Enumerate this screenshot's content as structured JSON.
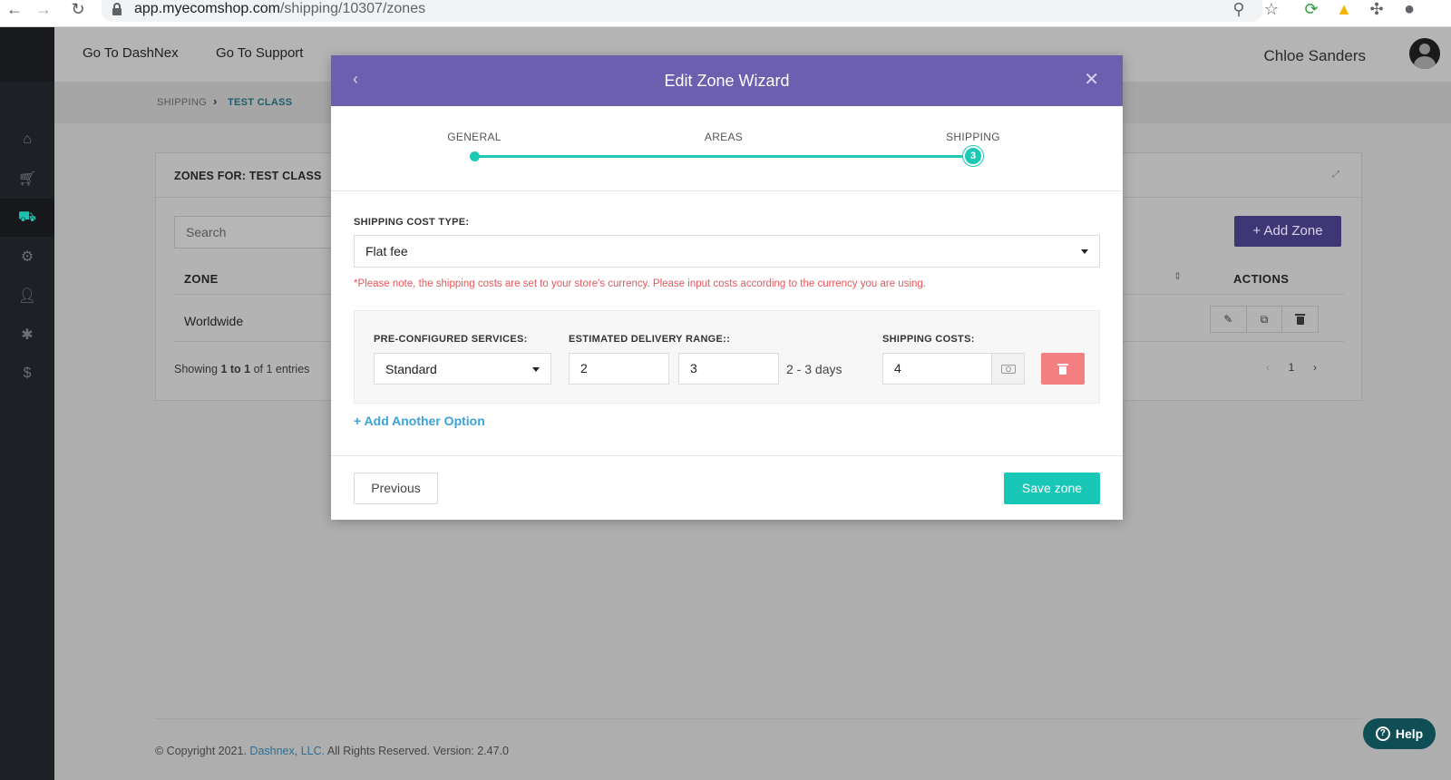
{
  "browser": {
    "url_host": "app.myecomshop.com",
    "url_path": "/shipping/10307/zones"
  },
  "header": {
    "link_dashnex": "Go To DashNex",
    "link_support": "Go To Support",
    "user_name": "Chloe Sanders"
  },
  "breadcrumb": {
    "items": [
      "SHIPPING",
      "TEST CLASS"
    ]
  },
  "card": {
    "title": "ZONES FOR: TEST CLASS",
    "search_placeholder": "Search",
    "add_zone_label": "Add Zone",
    "col_zone": "ZONE",
    "col_actions": "ACTIONS",
    "rows": [
      {
        "zone": "Worldwide"
      }
    ],
    "showing_prefix": "Showing ",
    "showing_from": "1",
    "showing_to_word": " to ",
    "showing_to": "1",
    "showing_of": " of 1 entries",
    "page_current": "1"
  },
  "footer": {
    "copyright": "© Copyright 2021. ",
    "company": "Dashnex, LLC.",
    "rest": " All Rights Reserved. Version: 2.47.0"
  },
  "help": {
    "label": "Help"
  },
  "modal": {
    "title": "Edit Zone Wizard",
    "steps": [
      "GENERAL",
      "AREAS",
      "SHIPPING"
    ],
    "current_step": "3",
    "cost_type_label": "SHIPPING COST TYPE:",
    "cost_type_value": "Flat fee",
    "currency_note": "*Please note, the shipping costs are set to your store's currency. Please input costs according to the currency you are using.",
    "services_label": "PRE-CONFIGURED SERVICES:",
    "services_value": "Standard",
    "delivery_label": "ESTIMATED DELIVERY RANGE::",
    "delivery_min": "2",
    "delivery_max": "3",
    "delivery_text": "2 - 3 days",
    "costs_label": "SHIPPING COSTS:",
    "costs_value": "4",
    "add_option_label": "+ Add Another Option",
    "previous_label": "Previous",
    "save_label": "Save zone"
  },
  "colors": {
    "modal_header": "#6c5fb0",
    "accent_teal": "#18c7b6",
    "danger": "#f47f80",
    "note_red": "#e8565b",
    "link_blue": "#3aa3d8"
  }
}
